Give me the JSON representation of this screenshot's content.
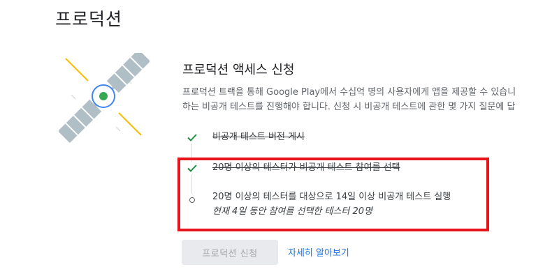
{
  "header": {
    "title": "프로덕션"
  },
  "section": {
    "title": "프로덕션 액세스 신청",
    "description_lines": [
      "프로덕션 트랙을 통해 Google Play에서 수십억 명의 사용자에게 앱을 제공할 수 있습니",
      "하는 비공개 테스트를 진행해야 합니다. 신청 시 비공개 테스트에 관한 몇 가지 질문에 답"
    ]
  },
  "steps": [
    {
      "label": "비공개 테스트 버전 게시",
      "status": "done"
    },
    {
      "label": "20명 이상의 테스터가 비공개 테스트 참여를 선택",
      "status": "done"
    },
    {
      "label": "20명 이상의 테스터를 대상으로 14일 이상 비공개 테스트 실행",
      "sublabel": "현재 4일 동안 참여를 선택한 테스터 20명",
      "status": "in-progress"
    }
  ],
  "actions": {
    "apply_label": "프로덕션 신청",
    "learn_more_label": "자세히 알아보기"
  },
  "icons": {
    "illustration": "satellite-icon",
    "done": "checkmark-icon",
    "pending": "circle-icon"
  },
  "colors": {
    "check": "#1e8e3e",
    "link": "#1a73e8",
    "highlight": "#e8141b",
    "satellite_core": "#34a853",
    "satellite_ring": "#4285f4",
    "panel": "#b0bec5",
    "beam": "#fbbc04"
  }
}
